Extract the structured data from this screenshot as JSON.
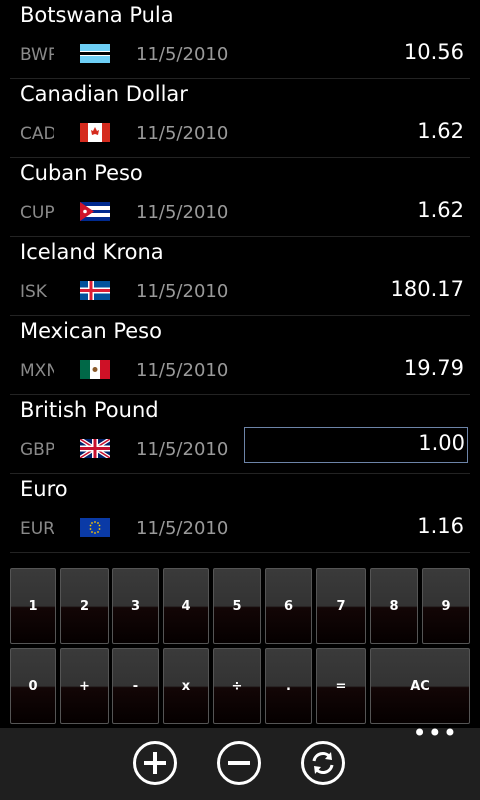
{
  "currencies": [
    {
      "name": "Botswana Pula",
      "code": "BWP",
      "flag_icon": "botswana-flag-icon",
      "date": "11/5/2010",
      "value": "10.56"
    },
    {
      "name": "Canadian Dollar",
      "code": "CAD",
      "flag_icon": "canada-flag-icon",
      "date": "11/5/2010",
      "value": "1.62"
    },
    {
      "name": "Cuban Peso",
      "code": "CUP",
      "flag_icon": "cuba-flag-icon",
      "date": "11/5/2010",
      "value": "1.62"
    },
    {
      "name": "Iceland Krona",
      "code": "ISK",
      "flag_icon": "iceland-flag-icon",
      "date": "11/5/2010",
      "value": "180.17"
    },
    {
      "name": "Mexican Peso",
      "code": "MXN",
      "flag_icon": "mexico-flag-icon",
      "date": "11/5/2010",
      "value": "19.79"
    },
    {
      "name": "British Pound",
      "code": "GBP",
      "flag_icon": "uk-flag-icon",
      "date": "11/5/2010",
      "value": "1.00",
      "editing": true
    },
    {
      "name": "Euro",
      "code": "EUR",
      "flag_icon": "eu-flag-icon",
      "date": "11/5/2010",
      "value": "1.16"
    }
  ],
  "keypad": {
    "row1": [
      "1",
      "2",
      "3",
      "4",
      "5",
      "6",
      "7",
      "8",
      "9"
    ],
    "row2": [
      "0",
      "+",
      "-",
      "x",
      "÷",
      ".",
      "=",
      "AC"
    ]
  },
  "appbar": {
    "buttons": [
      {
        "icon": "add-circle-icon",
        "label": "add"
      },
      {
        "icon": "remove-circle-icon",
        "label": "remove"
      },
      {
        "icon": "refresh-circle-icon",
        "label": "refresh"
      }
    ],
    "more_icon": "ellipsis-icon",
    "more_text": "•••"
  },
  "colors": {
    "accent": "#6d84a8",
    "background": "#000000",
    "appbar": "#1f1f1f"
  }
}
